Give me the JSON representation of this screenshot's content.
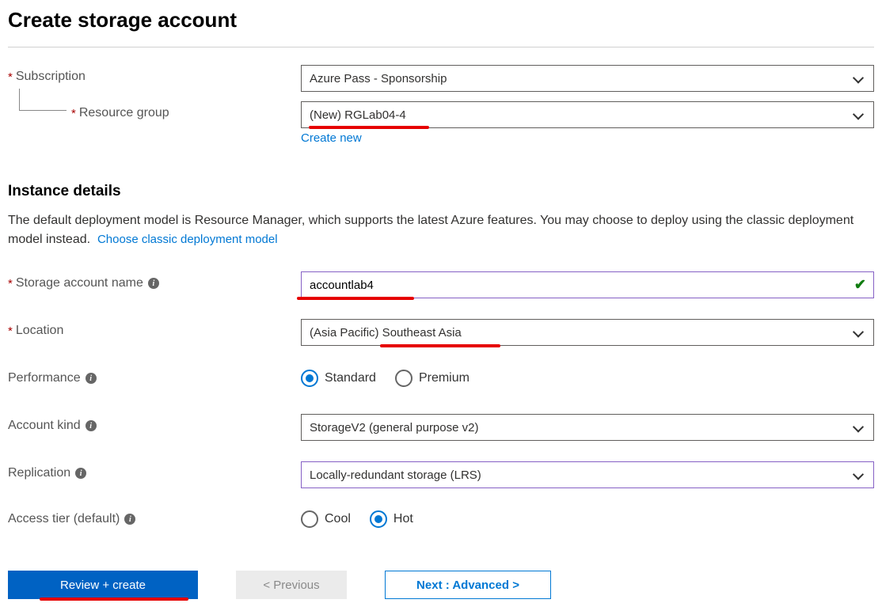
{
  "page": {
    "title": "Create storage account"
  },
  "subscription": {
    "label": "Subscription",
    "value": "Azure Pass - Sponsorship"
  },
  "resourceGroup": {
    "label": "Resource group",
    "value": "(New) RGLab04-4",
    "createNewLink": "Create new"
  },
  "instanceDetails": {
    "sectionTitle": "Instance details",
    "description": "The default deployment model is Resource Manager, which supports the latest Azure features. You may choose to deploy using the classic deployment model instead.",
    "classicLink": "Choose classic deployment model"
  },
  "storageAccountName": {
    "label": "Storage account name",
    "value": "accountlab4"
  },
  "location": {
    "label": "Location",
    "value": "(Asia Pacific) Southeast Asia"
  },
  "performance": {
    "label": "Performance",
    "options": {
      "standard": "Standard",
      "premium": "Premium"
    },
    "selected": "standard"
  },
  "accountKind": {
    "label": "Account kind",
    "value": "StorageV2 (general purpose v2)"
  },
  "replication": {
    "label": "Replication",
    "value": "Locally-redundant storage (LRS)"
  },
  "accessTier": {
    "label": "Access tier (default)",
    "options": {
      "cool": "Cool",
      "hot": "Hot"
    },
    "selected": "hot"
  },
  "buttons": {
    "review": "Review + create",
    "previous": "< Previous",
    "next": "Next : Advanced >"
  }
}
